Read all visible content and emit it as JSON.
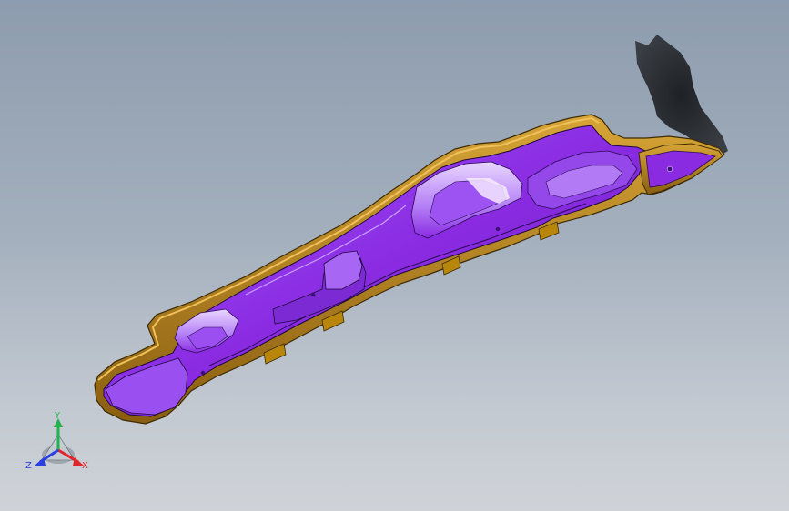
{
  "viewport": {
    "background_top": "#8d9cae",
    "background_bottom": "#cfd3d8"
  },
  "model": {
    "part_color": "#8a2be2",
    "flange_color": "#b8860b",
    "shadow_color": "#2f3338"
  },
  "triad": {
    "x_label": "X",
    "y_label": "Y",
    "z_label": "Z",
    "x_color": "#e0262b",
    "y_color": "#22b34a",
    "z_color": "#2b3fe0"
  }
}
